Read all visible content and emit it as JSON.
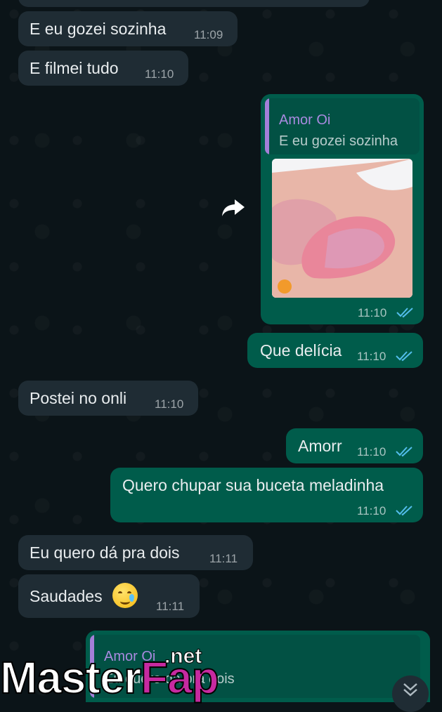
{
  "messages": [
    {
      "id": "m1",
      "text": "E eu gozei sozinha",
      "time": "11:09"
    },
    {
      "id": "m2",
      "text": "E filmei tudo",
      "time": "11:10"
    },
    {
      "id": "m3",
      "quote_author": "Amor Oi",
      "quote_text": "E eu gozei sozinha",
      "time": "11:10",
      "media": "image"
    },
    {
      "id": "m4",
      "text": "Que delícia",
      "time": "11:10"
    },
    {
      "id": "m5",
      "text": "Postei no onli",
      "time": "11:10"
    },
    {
      "id": "m6",
      "text": "Amorr",
      "time": "11:10"
    },
    {
      "id": "m7",
      "text": "Quero chupar sua buceta meladinha",
      "time": "11:10"
    },
    {
      "id": "m8",
      "text": "Eu quero dá pra dois",
      "time": "11:11"
    },
    {
      "id": "m9",
      "text": "Saudades",
      "time": "11:11",
      "emoji": "crying-face"
    },
    {
      "id": "m10",
      "quote_author": "Amor Oi",
      "quote_text": "Eu quero dá pra dois"
    }
  ],
  "watermark": {
    "part1": "Master",
    "part2": "Fap",
    "part3": ".net"
  },
  "colors": {
    "incoming": "#1f2c34",
    "outgoing": "#005c4b",
    "read_ticks": "#53bdeb",
    "quote_author": "#a98ae0"
  }
}
